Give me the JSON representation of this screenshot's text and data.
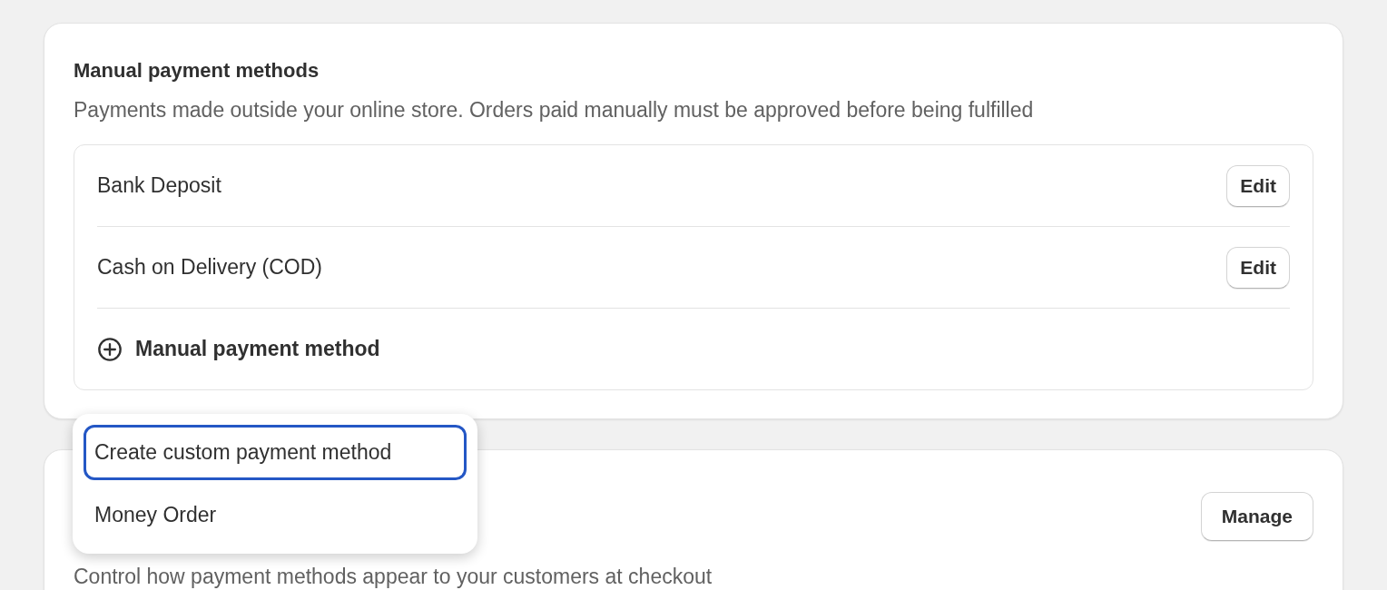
{
  "manual_payment_methods": {
    "title": "Manual payment methods",
    "description": "Payments made outside your online store. Orders paid manually must be approved before being fulfilled",
    "methods": [
      {
        "label": "Bank Deposit",
        "action": "Edit"
      },
      {
        "label": "Cash on Delivery (COD)",
        "action": "Edit"
      }
    ],
    "add_button": "Manual payment method"
  },
  "dropdown_menu": {
    "items": [
      {
        "label": "Create custom payment method",
        "selected": true
      },
      {
        "label": "Money Order",
        "selected": false
      }
    ]
  },
  "checkout_card": {
    "description": "Control how payment methods appear to your customers at checkout",
    "button": "Manage"
  }
}
